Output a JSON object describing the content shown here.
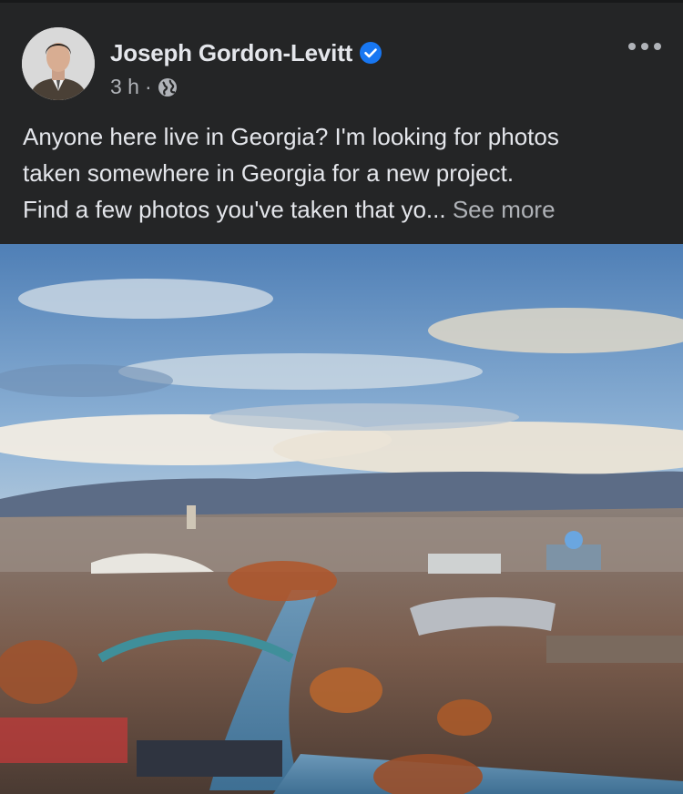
{
  "post": {
    "author": "Joseph Gordon-Levitt",
    "time": "3 h",
    "separator": "·",
    "privacy_icon": "globe-icon",
    "verified_icon": "verified-badge-icon",
    "more_icon": "more-options-icon",
    "text_lines": [
      "Anyone here live in Georgia? I'm looking for photos",
      "taken somewhere in Georgia for a new project.",
      "Find a few photos you've taken that yo..."
    ],
    "see_more": "See more"
  },
  "colors": {
    "background": "#242526",
    "primary_text": "#e4e6eb",
    "secondary_text": "#b0b3b8",
    "verified_blue": "#1877f2"
  }
}
